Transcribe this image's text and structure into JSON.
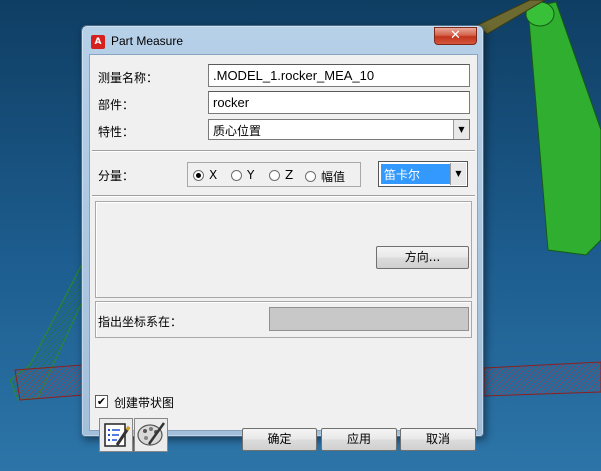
{
  "window": {
    "title": "Part Measure",
    "app_icon_letter": "A",
    "close_glyph": "✕"
  },
  "form": {
    "measure_name_label": "测量名称：",
    "measure_name_value": ".MODEL_1.rocker_MEA_10",
    "part_label": "部件：",
    "part_value": "rocker",
    "characteristic_label": "特性：",
    "characteristic_value": "质心位置",
    "component_label": "分量：",
    "components": [
      {
        "label": "X",
        "selected": true
      },
      {
        "label": "Y",
        "selected": false
      },
      {
        "label": "Z",
        "selected": false
      },
      {
        "label": "幅值",
        "selected": false
      }
    ],
    "coord_system_value": "笛卡尔",
    "direction_button": "方向...",
    "ref_frame_label": "指出坐标系在：",
    "ref_frame_value": "",
    "create_strip_chart_label": "创建带状图",
    "create_strip_chart_checked": true,
    "check_glyph": "✔"
  },
  "buttons": {
    "ok": "确定",
    "apply": "应用",
    "cancel": "取消"
  },
  "icons": {
    "dropdown_arrow": "▼",
    "info_editor": "info-editor-icon",
    "palette": "palette-icon"
  },
  "colors": {
    "selection": "#3399ff",
    "link_green": "#2fae2f",
    "link_red": "#7a1e2a",
    "background_blue": "#1d5d8f"
  }
}
